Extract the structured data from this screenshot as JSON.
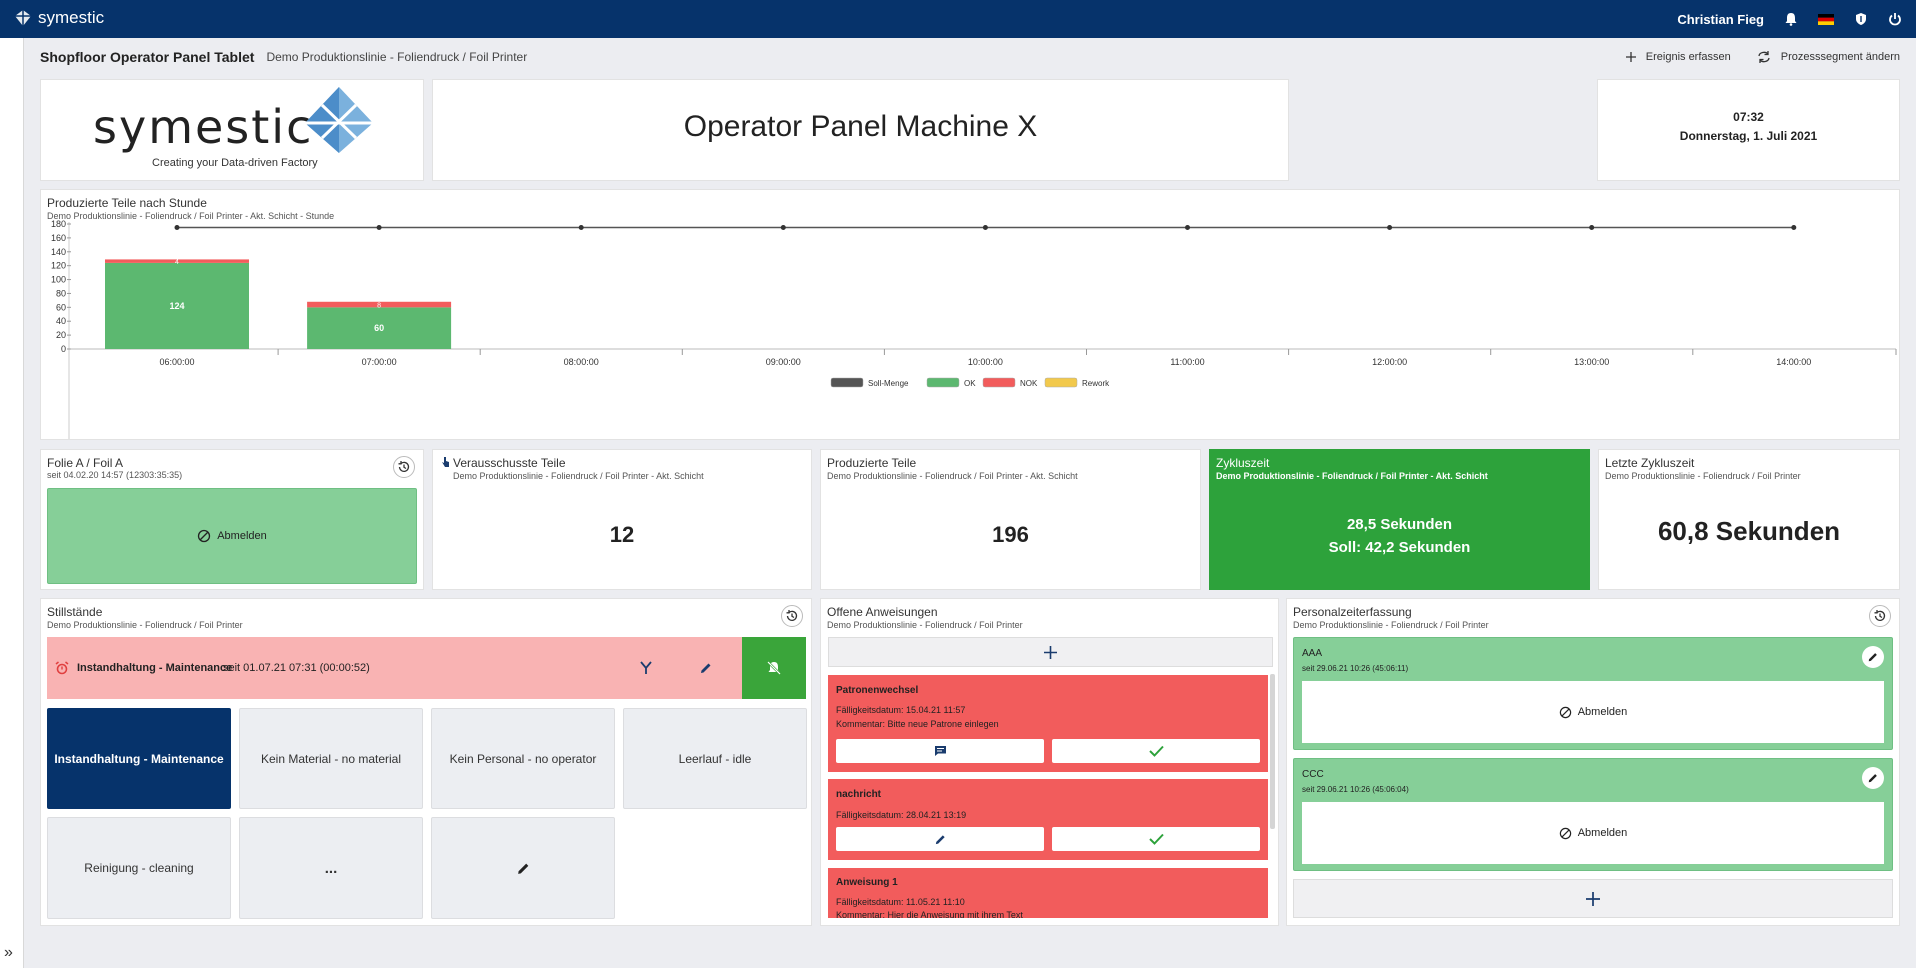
{
  "app": {
    "brand": "symestic",
    "user": "Christian Fieg"
  },
  "header": {
    "title": "Shopfloor Operator Panel Tablet",
    "breadcrumb": "Demo Produktionslinie - Foliendruck / Foil Printer",
    "actions": [
      "Ereignis erfassen",
      "Prozesssegment ändern"
    ]
  },
  "logo": {
    "name": "symestic",
    "tagline": "Creating your Data-driven Factory"
  },
  "banner": {
    "title": "Operator Panel Machine X"
  },
  "clock": {
    "time": "07:32",
    "date": "Donnerstag, 1. Juli 2021"
  },
  "chart": {
    "title": "Produzierte Teile nach Stunde",
    "subtitle": "Demo Produktionslinie - Foliendruck / Foil Printer - Akt. Schicht - Stunde"
  },
  "chart_data": {
    "type": "bar",
    "categories": [
      "06:00:00",
      "07:00:00",
      "08:00:00",
      "09:00:00",
      "10:00:00",
      "11:00:00",
      "12:00:00",
      "13:00:00",
      "14:00:00"
    ],
    "series": [
      {
        "name": "Soll-Menge",
        "type": "line",
        "values": [
          175,
          175,
          175,
          175,
          175,
          175,
          175,
          175,
          175
        ],
        "color": "#555555"
      },
      {
        "name": "OK",
        "values": [
          124,
          60,
          0,
          0,
          0,
          0,
          0,
          0,
          0
        ],
        "color": "#5cb870"
      },
      {
        "name": "NOK",
        "values": [
          5,
          8,
          0,
          0,
          0,
          0,
          0,
          0,
          0
        ],
        "color": "#f25c5c"
      },
      {
        "name": "Rework",
        "values": [
          0,
          0,
          0,
          0,
          0,
          0,
          0,
          0,
          0
        ],
        "color": "#f2c94c"
      }
    ],
    "data_labels": {
      "ok": [
        "124",
        "60"
      ],
      "nok": [
        "4",
        "8"
      ]
    },
    "yticks": [
      0,
      20,
      40,
      60,
      80,
      100,
      120,
      140,
      160,
      180
    ],
    "ylim": [
      0,
      180
    ],
    "legend": "bottom"
  },
  "folie": {
    "title": "Folie A / Foil A",
    "since": "seit 04.02.20 14:57 (12303:35:35)",
    "button": "Abmelden"
  },
  "scrap": {
    "title": "Verausschusste Teile",
    "sub": "Demo Produktionslinie - Foliendruck / Foil Printer - Akt. Schicht",
    "value": "12"
  },
  "produced": {
    "title": "Produzierte Teile",
    "sub": "Demo Produktionslinie - Foliendruck / Foil Printer - Akt. Schicht",
    "value": "196"
  },
  "cycle": {
    "title": "Zykluszeit",
    "sub": "Demo Produktionslinie - Foliendruck / Foil Printer - Akt. Schicht",
    "line1": "28,5 Sekunden",
    "line2": "Soll: 42,2 Sekunden",
    "color": "#2da23b"
  },
  "lastcycle": {
    "title": "Letzte Zykluszeit",
    "sub": "Demo Produktionslinie - Foliendruck / Foil Printer",
    "value": "60,8 Sekunden"
  },
  "downtime": {
    "title": "Stillstände",
    "sub": "Demo Produktionslinie - Foliendruck / Foil Printer",
    "active": {
      "label": "Instandhaltung - Maintenance",
      "since": "seit 01.07.21 07:31 (00:00:52)"
    },
    "tiles": [
      "Instandhaltung - Maintenance",
      "Kein Material - no material",
      "Kein Personal - no operator",
      "Leerlauf - idle",
      "Reinigung - cleaning",
      "..."
    ]
  },
  "instructions": {
    "title": "Offene Anweisungen",
    "sub": "Demo Produktionslinie - Foliendruck / Foil Printer",
    "items": [
      {
        "title": "Patronenwechsel",
        "due": "Fälligkeitsdatum: 15.04.21 11:57",
        "comment": "Kommentar: Bitte neue Patrone einlegen"
      },
      {
        "title": "nachricht",
        "due": "Fälligkeitsdatum: 28.04.21 13:19"
      },
      {
        "title": "Anweisung 1",
        "due": "Fälligkeitsdatum: 11.05.21 11:10",
        "comment": "Kommentar: Hier die Anweisung mit ihrem Text"
      }
    ]
  },
  "personnel": {
    "title": "Personalzeiterfassung",
    "sub": "Demo Produktionslinie - Foliendruck / Foil Printer",
    "entries": [
      {
        "name": "AAA",
        "since": "seit 29.06.21 10:26 (45:06:11)",
        "button": "Abmelden"
      },
      {
        "name": "CCC",
        "since": "seit 29.06.21 10:26 (45:06:04)",
        "button": "Abmelden"
      }
    ]
  }
}
